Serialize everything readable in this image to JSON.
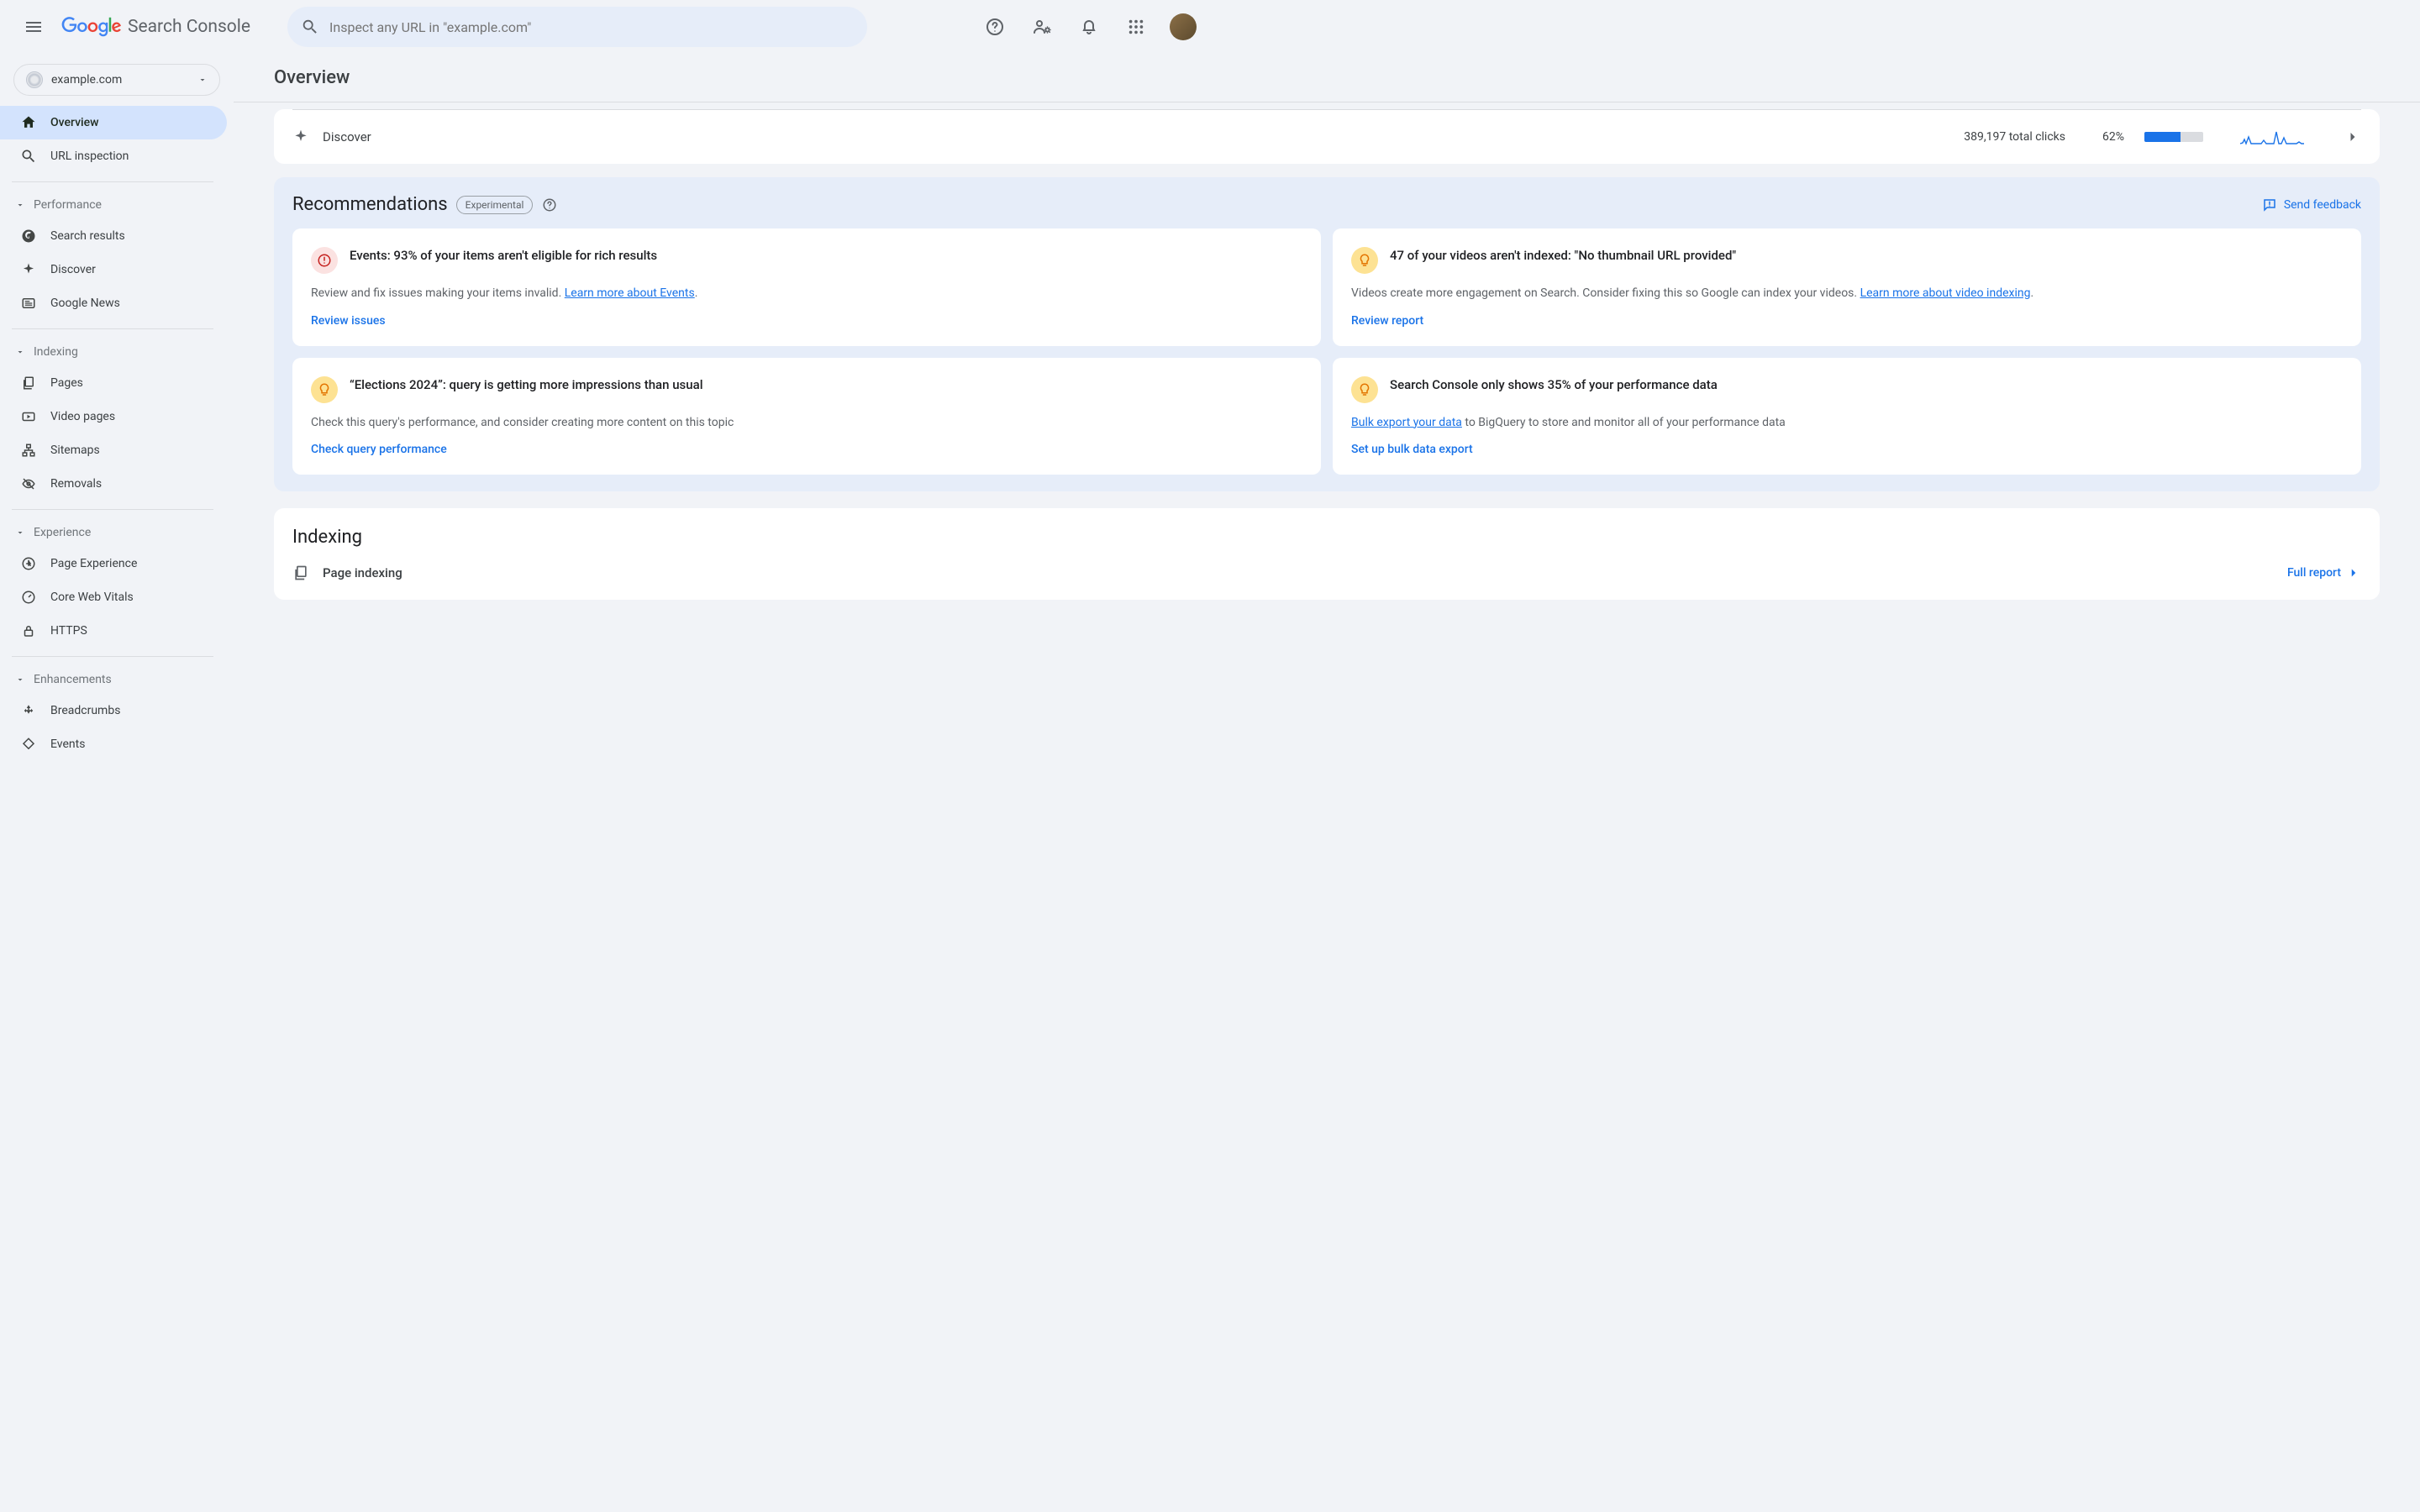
{
  "header": {
    "product": "Search Console",
    "search_placeholder": "Inspect any URL in \"example.com\""
  },
  "property": {
    "domain": "example.com"
  },
  "page_title": "Overview",
  "sidebar": {
    "primary": [
      {
        "label": "Overview"
      },
      {
        "label": "URL inspection"
      }
    ],
    "sections": [
      {
        "title": "Performance",
        "items": [
          "Search results",
          "Discover",
          "Google News"
        ]
      },
      {
        "title": "Indexing",
        "items": [
          "Pages",
          "Video pages",
          "Sitemaps",
          "Removals"
        ]
      },
      {
        "title": "Experience",
        "items": [
          "Page Experience",
          "Core Web Vitals",
          "HTTPS"
        ]
      },
      {
        "title": "Enhancements",
        "items": [
          "Breadcrumbs",
          "Events"
        ]
      }
    ]
  },
  "discover": {
    "label": "Discover",
    "clicks": "389,197 total clicks",
    "pct": "62%",
    "pct_value": 62
  },
  "recommendations": {
    "title": "Recommendations",
    "badge": "Experimental",
    "send_feedback": "Send feedback",
    "cards": [
      {
        "title": "Events: 93% of your items aren't eligible for rich results",
        "desc_pre": "Review and fix issues making your items invalid. ",
        "desc_link": "Learn more about Events",
        "desc_post": ".",
        "action": "Review issues",
        "icon": "red"
      },
      {
        "title": "47 of your videos aren't indexed: \"No thumbnail URL provided\"",
        "desc_pre": "Videos create more engagement on Search. Consider fixing this so Google can index your videos. ",
        "desc_link": "Learn more about video indexing",
        "desc_post": ".",
        "action": "Review report",
        "icon": "yellow"
      },
      {
        "title": "“Elections 2024”: query is getting more impressions than usual",
        "desc_pre": "Check this query's performance, and consider creating more content on this topic",
        "desc_link": "",
        "desc_post": "",
        "action": "Check query performance",
        "icon": "yellow"
      },
      {
        "title": "Search Console only shows 35% of your performance data",
        "desc_link_first": "Bulk export your data",
        "desc_post": " to BigQuery to store and monitor all of your performance data",
        "action": "Set up bulk data export",
        "icon": "yellow"
      }
    ]
  },
  "indexing": {
    "title": "Indexing",
    "row_label": "Page indexing",
    "full_report": "Full report"
  },
  "chart_data": {
    "type": "line",
    "title": "Discover clicks sparkline",
    "x": [
      1,
      2,
      3,
      4,
      5,
      6,
      7,
      8,
      9,
      10,
      11,
      12,
      13,
      14,
      15,
      16,
      17,
      18,
      19,
      20,
      21,
      22,
      23,
      24,
      25,
      26,
      27,
      28,
      29,
      30,
      31,
      32,
      33
    ],
    "values": [
      2,
      2,
      4,
      2,
      6,
      2,
      2,
      2,
      2,
      2,
      2,
      2,
      5,
      2,
      2,
      2,
      2,
      10,
      2,
      2,
      2,
      7,
      2,
      2,
      2,
      2,
      2,
      2,
      2,
      2,
      3,
      2,
      2
    ],
    "ylim": [
      0,
      10
    ]
  }
}
